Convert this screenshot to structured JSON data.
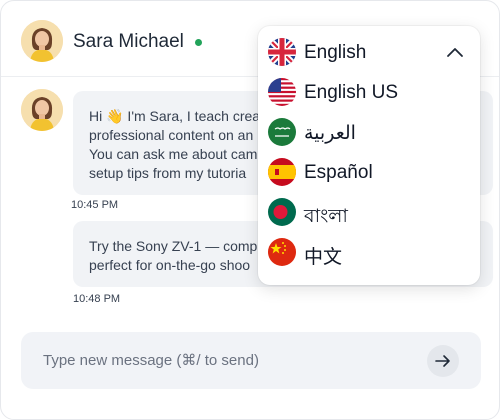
{
  "header": {
    "name": "Sara Michael",
    "status_color": "#22a35a"
  },
  "messages": [
    {
      "lines": [
        "Hi 👋 I'm Sara, I teach crea",
        "professional content on an",
        "You can ask me about cam",
        "setup tips from my tutoria"
      ],
      "time": "10:45 PM"
    },
    {
      "lines": [
        "Try the Sony ZV-1 — comp",
        "perfect for on-the-go shoo"
      ],
      "time": "10:48 PM"
    }
  ],
  "composer": {
    "placeholder": "Type new message (⌘/ to send)",
    "send_icon": "arrow-right-icon"
  },
  "language_menu": {
    "expanded": true,
    "chevron_icon": "chevron-up-icon",
    "items": [
      {
        "label": "English",
        "flag": "uk-flag-icon"
      },
      {
        "label": "English US",
        "flag": "us-flag-icon"
      },
      {
        "label": "العربية",
        "flag": "saudi-flag-icon"
      },
      {
        "label": "Español",
        "flag": "spain-flag-icon"
      },
      {
        "label": "বাংলা",
        "flag": "bangladesh-flag-icon"
      },
      {
        "label": "中文",
        "flag": "china-flag-icon"
      }
    ]
  }
}
